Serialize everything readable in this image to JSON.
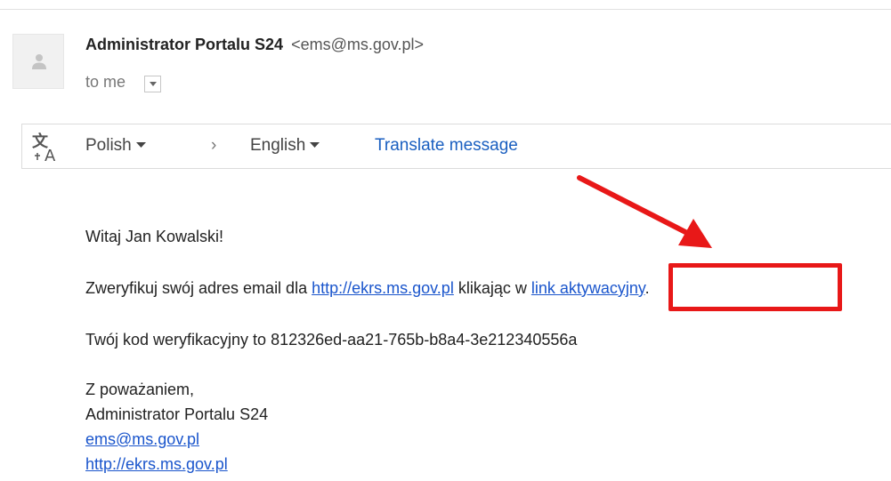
{
  "email": {
    "sender_name": "Administrator Portalu S24",
    "sender_email": "<ems@ms.gov.pl>",
    "recipient": "to me",
    "avatar_icon": "person-icon",
    "toggle_icon": "chevron-down-icon"
  },
  "translate_bar": {
    "icon": "translate-icon",
    "source_language": "Polish",
    "arrow": "›",
    "target_language": "English",
    "action_label": "Translate message"
  },
  "message": {
    "greeting": "Witaj Jan Kowalski!",
    "verify_prefix": "Zweryfikuj swój adres email dla ",
    "verify_url": "http://ekrs.ms.gov.pl",
    "verify_middle": " klikając w ",
    "verify_link_text": "link aktywacyjny",
    "verify_suffix": ".",
    "code_line": "Twój kod weryfikacyjny to 812326ed-aa21-765b-b8a4-3e212340556a",
    "closing": "Z poważaniem,",
    "signature_name": "Administrator Portalu S24",
    "signature_email": "ems@ms.gov.pl",
    "signature_url": "http://ekrs.ms.gov.pl"
  },
  "annotation": {
    "color": "#e81818"
  }
}
